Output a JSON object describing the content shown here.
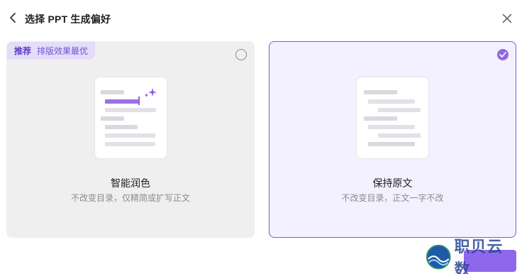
{
  "header": {
    "title": "选择 PPT 生成偏好"
  },
  "options": [
    {
      "tag_strong": "推荐",
      "tag_sub": "排版效果最优",
      "label": "智能润色",
      "description": "不改变目录，仅精简或扩写正文",
      "selected": false
    },
    {
      "label": "保持原文",
      "description": "不改变目录，正文一字不改",
      "selected": true
    }
  ],
  "footer": {
    "watermark_text": "职贝云数"
  },
  "colors": {
    "accent": "#8d6ae6",
    "selected_card_bg": "#f3f0ff",
    "selected_card_border": "#7c5cd6",
    "card_bg": "#efefef",
    "tag_bg": "#e5dcf8"
  },
  "icons": {
    "back": "chevron-left-icon",
    "close": "close-icon",
    "sparkle": "sparkle-icon",
    "check": "check-icon"
  }
}
